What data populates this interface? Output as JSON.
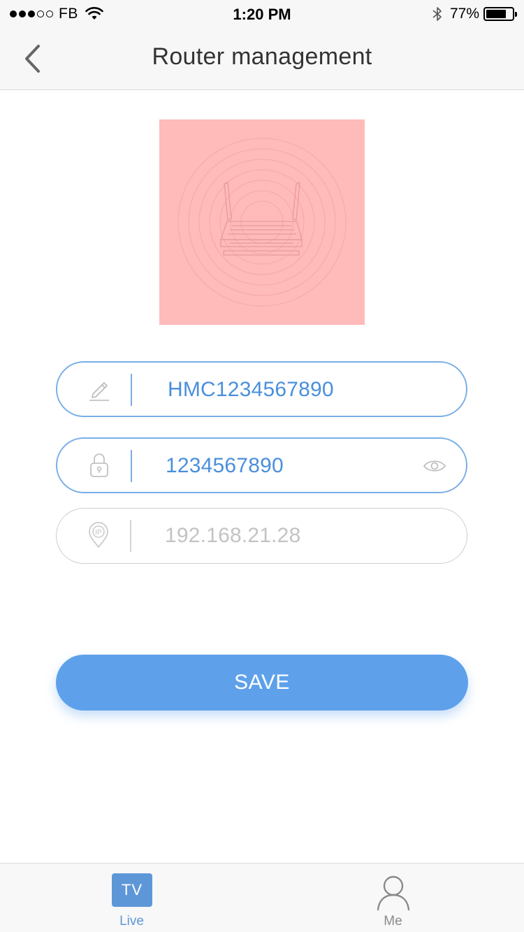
{
  "status_bar": {
    "carrier": "FB",
    "time": "1:20 PM",
    "battery": "77%",
    "battery_level": 0.77,
    "signal_bars_filled": 3,
    "signal_bars_total": 5
  },
  "nav": {
    "title": "Router management",
    "back_icon": "chevron-left-icon"
  },
  "router_image": {
    "icon": "router-icon",
    "background": "#ffbaba"
  },
  "fields": {
    "name": {
      "value": "HMC1234567890",
      "icon": "pencil-icon"
    },
    "password": {
      "value": "1234567890",
      "icon": "lock-icon",
      "toggle_icon": "eye-icon"
    },
    "ip": {
      "value": "192.168.21.28",
      "icon": "ip-location-icon"
    }
  },
  "save_button": {
    "label": "SAVE"
  },
  "tabs": [
    {
      "badge": "TV",
      "label": "Live",
      "active": true
    },
    {
      "label": "Me",
      "icon": "person-icon",
      "active": false
    }
  ],
  "colors": {
    "accent": "#5ea1ea",
    "field_border": "#7aaee6",
    "field_text": "#4a8fdc",
    "muted_text": "#c3c3c3"
  }
}
